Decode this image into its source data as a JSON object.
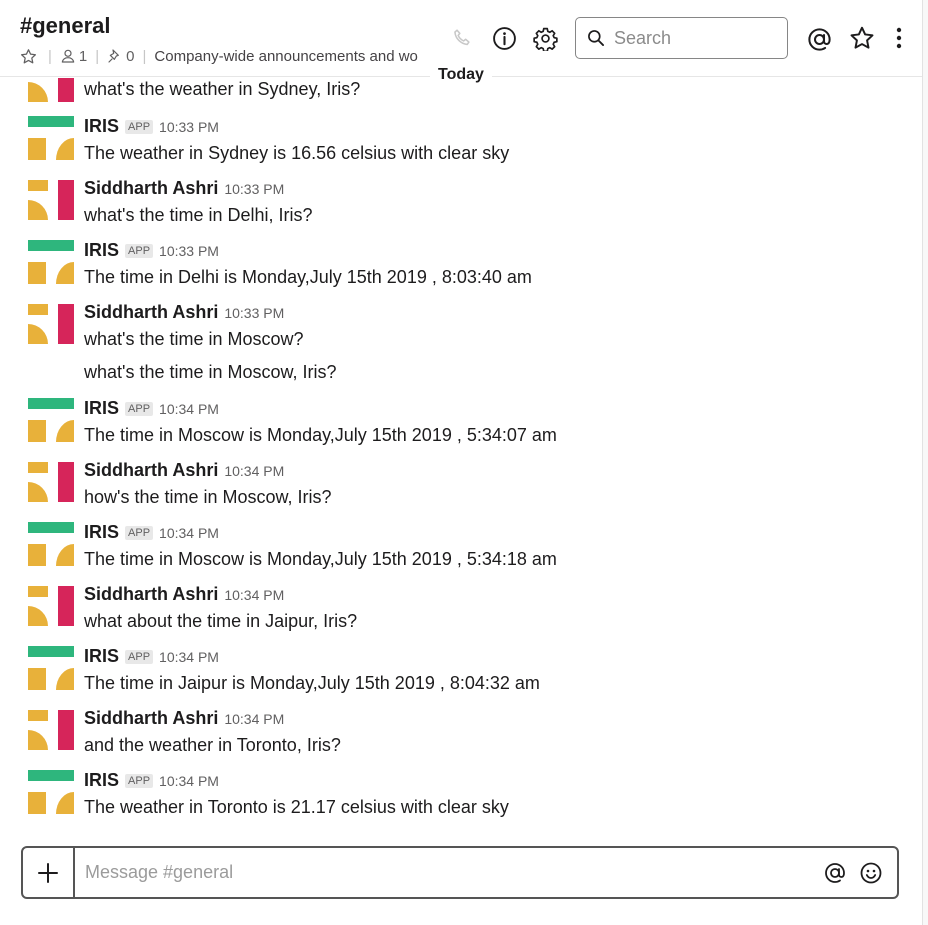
{
  "header": {
    "channel": "#general",
    "members": "1",
    "pins": "0",
    "topic": "Company-wide announcements and wo"
  },
  "search": {
    "placeholder": "Search"
  },
  "divider": {
    "label": "Today"
  },
  "messages": [
    {
      "sender": "",
      "badge": "",
      "time": "",
      "text": "what's the weather in Sydney, Iris?"
    },
    {
      "sender": "IRIS",
      "badge": "APP",
      "time": "10:33 PM",
      "text": "The weather in Sydney is 16.56 celsius with clear sky"
    },
    {
      "sender": "Siddharth Ashri",
      "badge": "",
      "time": "10:33 PM",
      "text": "what's the time in Delhi, Iris?"
    },
    {
      "sender": "IRIS",
      "badge": "APP",
      "time": "10:33 PM",
      "text": "The time in Delhi is Monday,July 15th 2019 , 8:03:40 am"
    },
    {
      "sender": "Siddharth Ashri",
      "badge": "",
      "time": "10:33 PM",
      "text": "what's the time in Moscow?"
    },
    {
      "sender": "",
      "badge": "",
      "time": "",
      "text": "what's the time in Moscow, Iris?"
    },
    {
      "sender": "IRIS",
      "badge": "APP",
      "time": "10:34 PM",
      "text": "The time in Moscow is Monday,July 15th 2019 , 5:34:07 am"
    },
    {
      "sender": "Siddharth Ashri",
      "badge": "",
      "time": "10:34 PM",
      "text": "how's the time in Moscow, Iris?"
    },
    {
      "sender": "IRIS",
      "badge": "APP",
      "time": "10:34 PM",
      "text": "The time in Moscow is Monday,July 15th 2019 , 5:34:18 am"
    },
    {
      "sender": "Siddharth Ashri",
      "badge": "",
      "time": "10:34 PM",
      "text": "what about the time in Jaipur, Iris?"
    },
    {
      "sender": "IRIS",
      "badge": "APP",
      "time": "10:34 PM",
      "text": "The time in Jaipur is Monday,July 15th 2019 , 8:04:32 am"
    },
    {
      "sender": "Siddharth Ashri",
      "badge": "",
      "time": "10:34 PM",
      "text": "and the weather in Toronto, Iris?"
    },
    {
      "sender": "IRIS",
      "badge": "APP",
      "time": "10:34 PM",
      "text": "The weather in Toronto is 21.17 celsius with clear sky"
    }
  ],
  "composer": {
    "placeholder": "Message #general"
  },
  "colors": {
    "avatar_yellow": "#e8b13a",
    "avatar_red": "#d6255a",
    "avatar_green": "#2eb67d"
  }
}
